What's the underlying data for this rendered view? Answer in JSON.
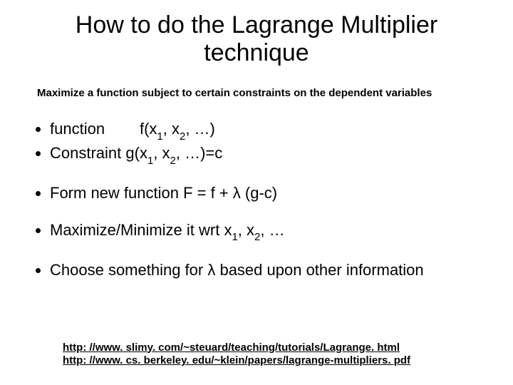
{
  "title": "How to do the Lagrange Multiplier technique",
  "subtitle": "Maximize a function subject to certain constraints on the dependent variables",
  "bullets": {
    "b1_pre": "function",
    "b1_fn": "f(x",
    "b1_mid1": ", x",
    "b1_tail": ", …)",
    "b2_pre": "Constraint   g(x",
    "b2_mid1": ", x",
    "b2_tail": ", …)=c",
    "b3_pre": "Form new function F = f + ",
    "b3_post": " (g-c)",
    "b4_pre": "Maximize/Minimize it wrt x",
    "b4_mid": ", x",
    "b4_tail": ", …",
    "b5_pre": "Choose something for ",
    "b5_post": " based upon other information"
  },
  "sub1": "1",
  "sub2": "2",
  "lambda": "λ",
  "links": {
    "l1": "http: //www. slimy. com/~steuard/teaching/tutorials/Lagrange. html",
    "l2": "http: //www. cs. berkeley. edu/~klein/papers/lagrange-multipliers. pdf"
  }
}
